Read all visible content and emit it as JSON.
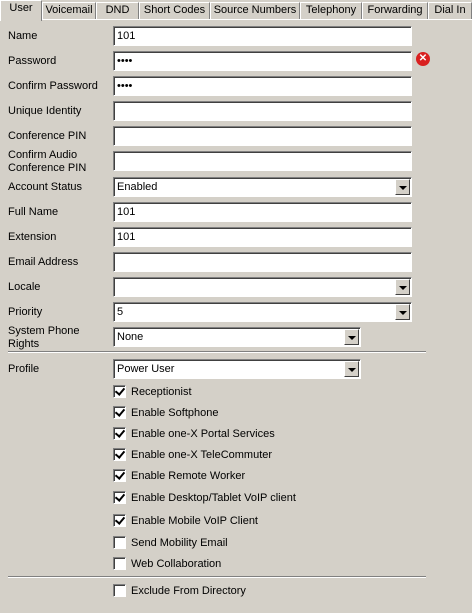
{
  "tabs": [
    "User",
    "Voicemail",
    "DND",
    "Short Codes",
    "Source Numbers",
    "Telephony",
    "Forwarding",
    "Dial In"
  ],
  "labels": {
    "name": "Name",
    "password": "Password",
    "confirm_password": "Confirm Password",
    "unique_identity": "Unique Identity",
    "conference_pin": "Conference PIN",
    "confirm_audio_pin": "Confirm Audio Conference PIN",
    "account_status": "Account Status",
    "full_name": "Full Name",
    "extension": "Extension",
    "email_address": "Email Address",
    "locale": "Locale",
    "priority": "Priority",
    "system_phone_rights": "System Phone Rights",
    "profile": "Profile"
  },
  "values": {
    "name": "101",
    "password": "••••",
    "confirm_password": "••••",
    "unique_identity": "",
    "conference_pin": "",
    "confirm_audio_pin": "",
    "account_status": "Enabled",
    "full_name": "101",
    "extension": "101",
    "email_address": "",
    "locale": "",
    "priority": "5",
    "system_phone_rights": "None",
    "profile": "Power User"
  },
  "error_icon": "close-x-icon",
  "options": [
    {
      "label": "Receptionist",
      "checked": true
    },
    {
      "label": "Enable Softphone",
      "checked": true
    },
    {
      "label": "Enable one-X Portal Services",
      "checked": true
    },
    {
      "label": "Enable one-X TeleCommuter",
      "checked": true
    },
    {
      "label": "Enable Remote Worker",
      "checked": true
    },
    {
      "label": "Enable Desktop/Tablet VoIP client",
      "checked": true
    },
    {
      "label": "Enable Mobile VoIP Client",
      "checked": true
    },
    {
      "label": "Send Mobility Email",
      "checked": false
    },
    {
      "label": "Web Collaboration",
      "checked": false
    }
  ],
  "exclude_from_directory": {
    "label": "Exclude From Directory",
    "checked": false
  }
}
